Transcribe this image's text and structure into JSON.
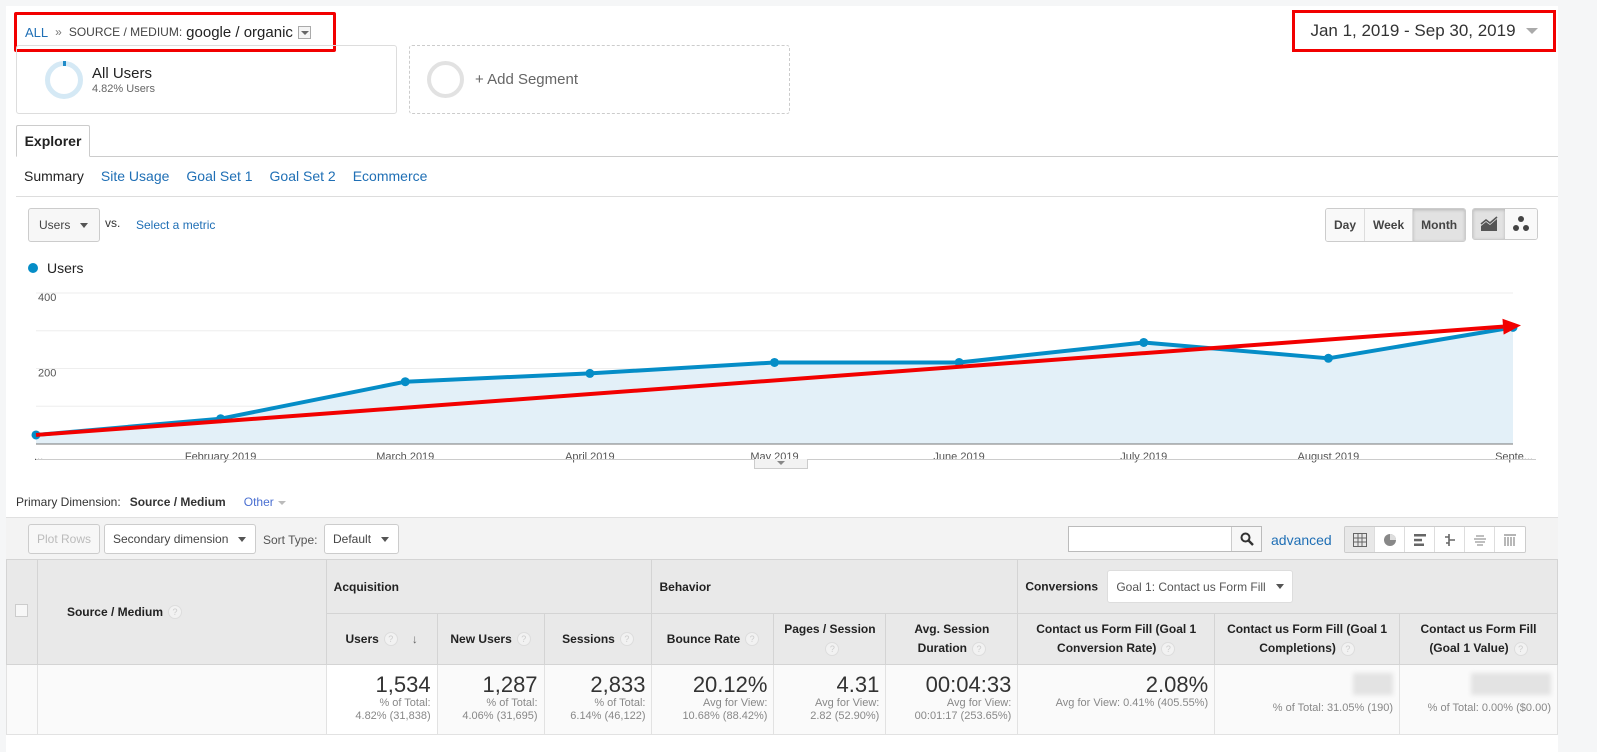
{
  "breadcrumb": {
    "root": "ALL",
    "separator": "»",
    "dimension_label": "SOURCE / MEDIUM:",
    "dimension_value": "google / organic"
  },
  "date_range": {
    "label": "Jan 1, 2019 - Sep 30, 2019"
  },
  "segments": {
    "active": {
      "title": "All Users",
      "subtitle": "4.82% Users"
    },
    "add_label": "+ Add Segment"
  },
  "tabs": {
    "explorer": "Explorer",
    "subtabs": [
      "Summary",
      "Site Usage",
      "Goal Set 1",
      "Goal Set 2",
      "Ecommerce"
    ],
    "active_subtab": "Summary"
  },
  "chart_controls": {
    "metric": "Users",
    "vs_label": "vs.",
    "select_metric": "Select a metric",
    "periods": [
      "Day",
      "Week",
      "Month"
    ],
    "active_period": "Month",
    "chart_types": [
      "line-chart-icon",
      "motion-chart-icon"
    ]
  },
  "colors": {
    "series": "#058dc7",
    "fill": "#e3f0f8",
    "annotation_arrow": "#f20000",
    "link": "#1f6fb5"
  },
  "chart_data": {
    "type": "area",
    "title": "",
    "legend": [
      "Users"
    ],
    "legend_position": "top-left",
    "x": [
      "...",
      "February 2019",
      "March 2019",
      "April 2019",
      "May 2019",
      "June 2019",
      "July 2019",
      "August 2019",
      "Septe..."
    ],
    "series": [
      {
        "name": "Users",
        "values": [
          24,
          67,
          165,
          187,
          216,
          216,
          269,
          227,
          309
        ]
      }
    ],
    "yticks": [
      200,
      400
    ],
    "ylim": [
      0,
      400
    ],
    "grid": true,
    "xlabel": "",
    "ylabel": "",
    "annotations": [
      {
        "type": "arrow",
        "color": "#f20000",
        "from": {
          "x": "...",
          "y": 24
        },
        "to": {
          "x": "Septe...",
          "y": 309
        }
      }
    ]
  },
  "primary_dimension": {
    "label": "Primary Dimension:",
    "current": "Source / Medium",
    "other": "Other"
  },
  "toolbar": {
    "plot_rows": "Plot Rows",
    "secondary_dimension": "Secondary dimension",
    "sort_type_label": "Sort Type:",
    "sort_type": "Default",
    "search_value": "",
    "advanced": "advanced",
    "views": [
      "table-view-icon",
      "pie-view-icon",
      "performance-view-icon",
      "comparison-view-icon",
      "term-cloud-icon",
      "pivot-view-icon"
    ]
  },
  "table": {
    "dimension_header": "Source / Medium",
    "groups": {
      "acquisition": "Acquisition",
      "behavior": "Behavior",
      "conversions": "Conversions",
      "conversion_goal": "Goal 1: Contact us Form Fill"
    },
    "columns": [
      "Users",
      "New Users",
      "Sessions",
      "Bounce Rate",
      "Pages / Session",
      "Avg. Session Duration",
      "Contact us Form Fill (Goal 1 Conversion Rate)",
      "Contact us Form Fill (Goal 1 Completions)",
      "Contact us Form Fill (Goal 1 Value)"
    ],
    "totals": [
      {
        "value": "1,534",
        "line1": "% of Total:",
        "line2": "4.82% (31,838)"
      },
      {
        "value": "1,287",
        "line1": "% of Total:",
        "line2": "4.06% (31,695)"
      },
      {
        "value": "2,833",
        "line1": "% of Total:",
        "line2": "6.14% (46,122)"
      },
      {
        "value": "20.12%",
        "line1": "Avg for View:",
        "line2": "10.68% (88.42%)"
      },
      {
        "value": "4.31",
        "line1": "Avg for View:",
        "line2": "2.82 (52.90%)"
      },
      {
        "value": "00:04:33",
        "line1": "Avg for View:",
        "line2": "00:01:17 (253.65%)"
      },
      {
        "value": "2.08%",
        "line1": "Avg for View: 0.41% (405.55%)",
        "line2": ""
      },
      {
        "value": "",
        "line1": "% of Total: 31.05% (190)",
        "line2": ""
      },
      {
        "value": "",
        "line1": "% of Total: 0.00% ($0.00)",
        "line2": ""
      }
    ]
  }
}
